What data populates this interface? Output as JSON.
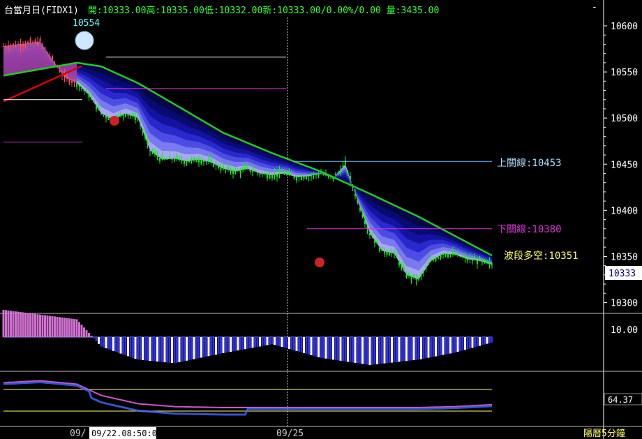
{
  "header": {
    "symbol": "台當月日(FIDX1)",
    "quote": "開:10333.00高:10335.00低:10332.00新:10333.00/0.00%/0.00 量:3435.00",
    "corner": "-"
  },
  "footer": {
    "date_left": "09/",
    "cursor_time": "09/22.08:50:00",
    "date_mid": "09/25",
    "mode": "陽曆5分鐘"
  },
  "labels": {
    "peak": "10554",
    "upper_line": "上關線:10453",
    "lower_line": "下關線:10380",
    "wave": "波段多空:10351",
    "last_price": "10333",
    "osc_value": "10.00",
    "ind_value": "64.37"
  },
  "colors": {
    "background": "#000000",
    "candle": "#00ff00",
    "ma_main": "#22cc22",
    "ma_start": "#dd0000",
    "band_dark": "#050550",
    "band_light": "#a0a0ff",
    "upper_line": "#60c0ff",
    "lower_line": "#dd33dd",
    "wave_text": "#ffff66",
    "axis": "#ffffff",
    "header_green": "#33ff33"
  },
  "chart_data": [
    {
      "type": "line",
      "title": "台當月日(FIDX1)",
      "y_ticks": [
        10600,
        10550,
        10500,
        10450,
        10400,
        10350,
        10300
      ],
      "ylim": [
        10285,
        10613
      ],
      "x_tick_labels": [
        "09/",
        "09/25"
      ],
      "series": [
        {
          "name": "",
          "x": [
            0,
            15,
            25,
            30,
            35,
            40,
            45,
            50,
            55,
            60,
            65,
            70,
            75,
            80,
            85,
            90,
            95,
            100,
            105,
            110,
            115,
            120,
            125,
            130,
            135,
            140,
            145,
            150,
            155,
            160,
            165,
            170,
            175,
            180,
            185,
            190,
            195,
            200
          ],
          "y": [
            10578,
            10583,
            10544,
            10538,
            10525,
            10505,
            10498,
            10505,
            10500,
            10465,
            10455,
            10456,
            10453,
            10455,
            10452,
            10445,
            10442,
            10445,
            10440,
            10438,
            10440,
            10436,
            10437,
            10440,
            10435,
            10450,
            10410,
            10375,
            10356,
            10353,
            10330,
            10325,
            10345,
            10353,
            10352,
            10347,
            10345,
            10341
          ]
        },
        {
          "name": "",
          "x": [
            0,
            30,
            40,
            55,
            70,
            90,
            110,
            130,
            150,
            170,
            185,
            200
          ],
          "y": [
            10546,
            10560,
            10556,
            10538,
            10515,
            10484,
            10462,
            10442,
            10418,
            10393,
            10372,
            10351
          ]
        }
      ],
      "annotations": [
        "10554",
        "上關線:10453",
        "下關線:10380",
        "波段多空:10351"
      ],
      "grid": false
    },
    {
      "type": "bar",
      "title": "",
      "y_ticks": [
        10.0
      ],
      "series": [
        {
          "name": "",
          "x": [
            0,
            30,
            40,
            55,
            70,
            90,
            110,
            130,
            150,
            170,
            185,
            200
          ],
          "y": [
            4.6,
            3.0,
            -1.6,
            -3.8,
            -4.4,
            -2.7,
            -1.2,
            -3.5,
            -4.7,
            -3.8,
            -2.6,
            -0.9
          ]
        }
      ]
    },
    {
      "type": "line",
      "title": "",
      "y_ticks": [
        64.37
      ],
      "series": [
        {
          "name": "",
          "x": [
            0,
            15,
            30,
            40,
            55,
            70,
            90,
            110,
            130,
            150,
            170,
            185,
            200
          ],
          "y": [
            91,
            95,
            88,
            65,
            48,
            42,
            40,
            40,
            40,
            40,
            40,
            42,
            46
          ]
        }
      ]
    }
  ]
}
